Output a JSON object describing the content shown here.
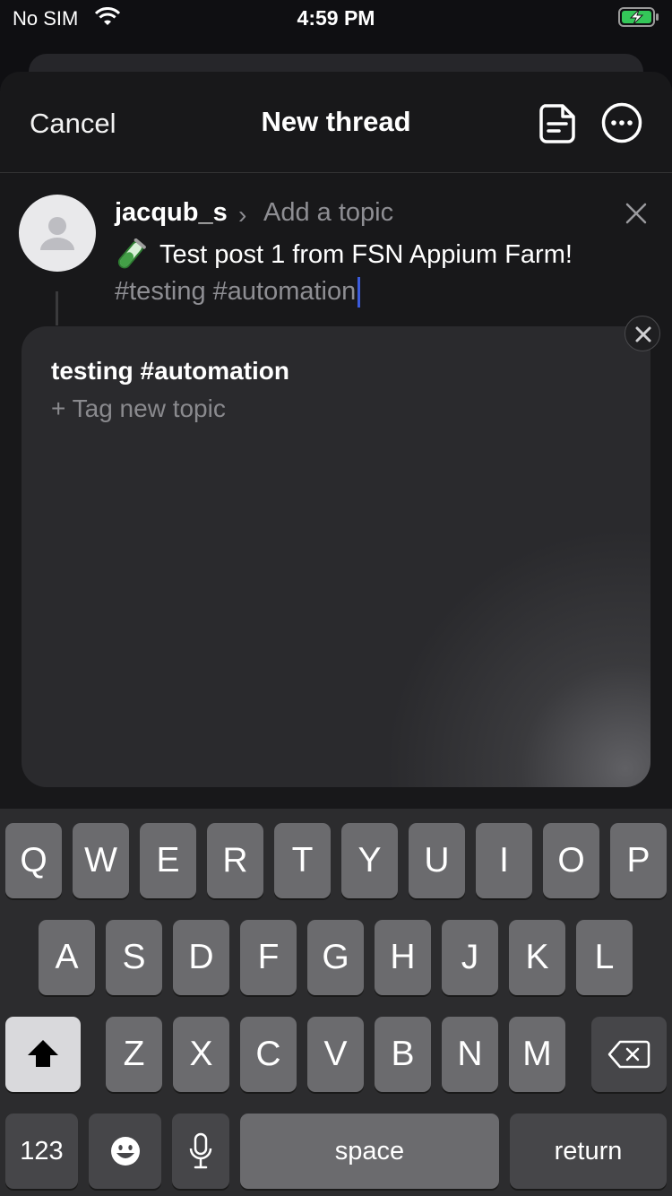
{
  "status_bar": {
    "carrier": "No SIM",
    "time": "4:59 PM"
  },
  "nav": {
    "cancel_label": "Cancel",
    "title": "New thread"
  },
  "post": {
    "username": "jacqub_s",
    "topic_placeholder": "Add a topic",
    "text_line1": "Test post 1 from FSN Appium Farm!",
    "text_line2": "#testing #automation",
    "emoji": "test-tube"
  },
  "topic_popover": {
    "suggestion": "testing #automation",
    "tag_new_topic": "+ Tag new topic"
  },
  "keyboard": {
    "row1": [
      "Q",
      "W",
      "E",
      "R",
      "T",
      "Y",
      "U",
      "I",
      "O",
      "P"
    ],
    "row2": [
      "A",
      "S",
      "D",
      "F",
      "G",
      "H",
      "J",
      "K",
      "L"
    ],
    "row3": [
      "Z",
      "X",
      "C",
      "V",
      "B",
      "N",
      "M"
    ],
    "numbers_label": "123",
    "space_label": "space",
    "return_label": "return"
  },
  "colors": {
    "background": "#18181a",
    "accent_caret": "#3b5bdb",
    "battery_green": "#34c759"
  }
}
